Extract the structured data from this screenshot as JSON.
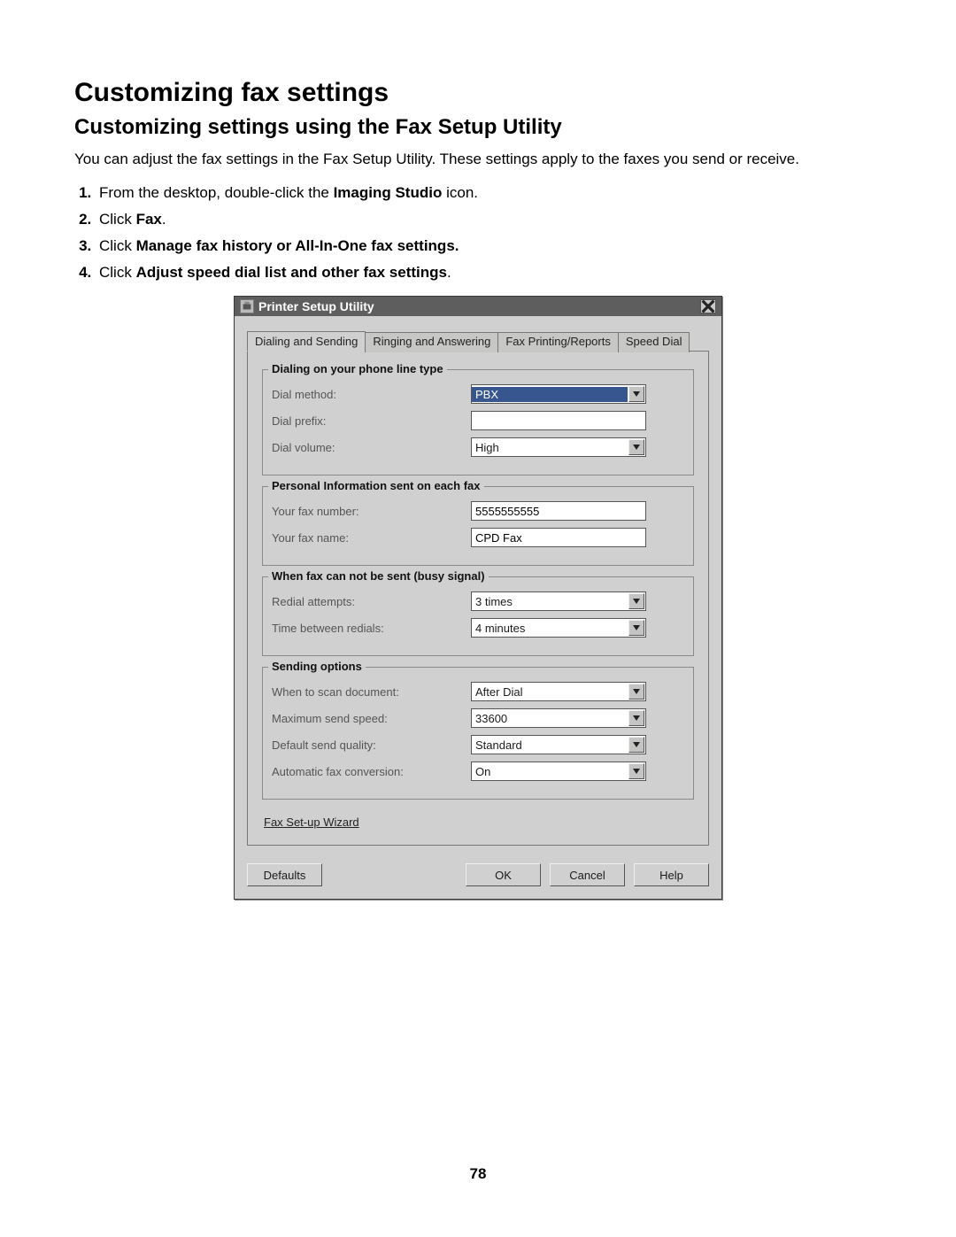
{
  "doc": {
    "h1": "Customizing fax settings",
    "h2": "Customizing settings using the Fax Setup Utility",
    "intro": "You can adjust the fax settings in the Fax Setup Utility. These settings apply to the faxes you send or receive.",
    "steps": {
      "s1_pre": "From the desktop, double-click the ",
      "s1_bold": "Imaging Studio",
      "s1_post": " icon.",
      "s2_pre": "Click ",
      "s2_bold": "Fax",
      "s2_post": ".",
      "s3_pre": "Click ",
      "s3_bold": "Manage fax history or All-In-One fax settings.",
      "s4_pre": "Click ",
      "s4_bold": "Adjust speed dial list and other fax settings",
      "s4_post": "."
    },
    "page_number": "78"
  },
  "dialog": {
    "title": "Printer Setup Utility",
    "tabs": [
      "Dialing and Sending",
      "Ringing and Answering",
      "Fax Printing/Reports",
      "Speed Dial"
    ],
    "groups": {
      "g1": {
        "legend": "Dialing on your phone line type",
        "dial_method_label": "Dial method:",
        "dial_method_value": "PBX",
        "dial_prefix_label": "Dial prefix:",
        "dial_prefix_value": "",
        "dial_volume_label": "Dial volume:",
        "dial_volume_value": "High"
      },
      "g2": {
        "legend": "Personal Information sent on each fax",
        "fax_number_label": "Your fax number:",
        "fax_number_value": "5555555555",
        "fax_name_label": "Your fax name:",
        "fax_name_value": "CPD Fax"
      },
      "g3": {
        "legend": "When fax can not be sent (busy signal)",
        "redial_attempts_label": "Redial attempts:",
        "redial_attempts_value": "3 times",
        "time_between_label": "Time between redials:",
        "time_between_value": "4 minutes"
      },
      "g4": {
        "legend": "Sending options",
        "when_scan_label": "When to scan document:",
        "when_scan_value": "After Dial",
        "max_speed_label": "Maximum send speed:",
        "max_speed_value": "33600",
        "quality_label": "Default send quality:",
        "quality_value": "Standard",
        "auto_conv_label": "Automatic fax conversion:",
        "auto_conv_value": "On"
      }
    },
    "wizard_link": "Fax Set-up Wizard",
    "buttons": {
      "defaults": "Defaults",
      "ok": "OK",
      "cancel": "Cancel",
      "help": "Help"
    }
  }
}
